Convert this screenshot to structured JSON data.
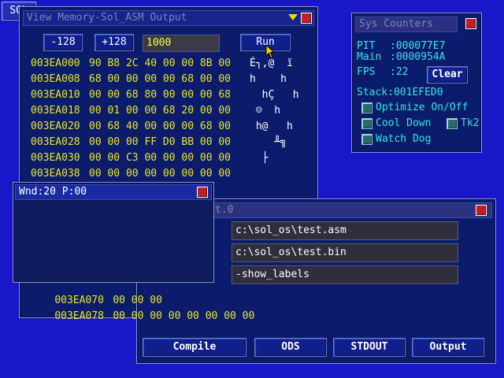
{
  "taskbar": {
    "sol_label": "SOL"
  },
  "memory_window": {
    "title": "View Memory-Sol_ASM Output",
    "minus_label": "-128",
    "plus_label": "+128",
    "address_value": "1000",
    "run_label": "Run",
    "rows": [
      {
        "addr": "003EA000",
        "bytes": "90 B8 2C 40 00 00 8B 00",
        "ascii": "É┐,@  ï"
      },
      {
        "addr": "003EA008",
        "bytes": "68 00 00 00 00 68 00 00",
        "ascii": "h    h"
      },
      {
        "addr": "003EA010",
        "bytes": "00 00 68 80 00 00 00 68",
        "ascii": "  hÇ   h"
      },
      {
        "addr": "003EA018",
        "bytes": "00 01 00 00 68 20 00 00",
        "ascii": " ☺  h"
      },
      {
        "addr": "003EA020",
        "bytes": "00 68 40 00 00 00 68 00",
        "ascii": " h@   h"
      },
      {
        "addr": "003EA028",
        "bytes": "00 00 00 FF D0 BB 00 00",
        "ascii": "    ╨╗"
      },
      {
        "addr": "003EA030",
        "bytes": "00 00 C3 00 00 00 00 00",
        "ascii": "  ├"
      },
      {
        "addr": "003EA038",
        "bytes": "00 00 00 00 00 00 00 00",
        "ascii": ""
      }
    ],
    "bottom_rows": [
      {
        "addr": "003EA070",
        "bytes": "00 00 00"
      },
      {
        "addr": "003EA078",
        "bytes": "00 00 00 00 00 00 00 00"
      }
    ]
  },
  "sys_counters": {
    "title": "Sys Counters",
    "pit_label": "PIT",
    "pit_value": ":000077E7",
    "main_label": "Main",
    "main_value": ":0000954A",
    "fps_label": "FPS",
    "fps_value": ":22",
    "clear_label": "Clear",
    "stack_text": "Stack:001EFED0",
    "optimize_label": "Optimize On/Off",
    "cooldown_label": "Cool Down",
    "tk2_label": "Tk2",
    "watchdog_label": "Watch Dog"
  },
  "wnd_window": {
    "title": "Wnd:20 P:00"
  },
  "asm_window": {
    "title_fragment": "t.0",
    "source_path": "c:\\sol_os\\test.asm",
    "binary_path": "c:\\sol_os\\test.bin",
    "options": "-show_labels",
    "compile_label": "Compile",
    "ods_label": "ODS",
    "stdout_label": "STDOUT",
    "output_label": "Output"
  }
}
